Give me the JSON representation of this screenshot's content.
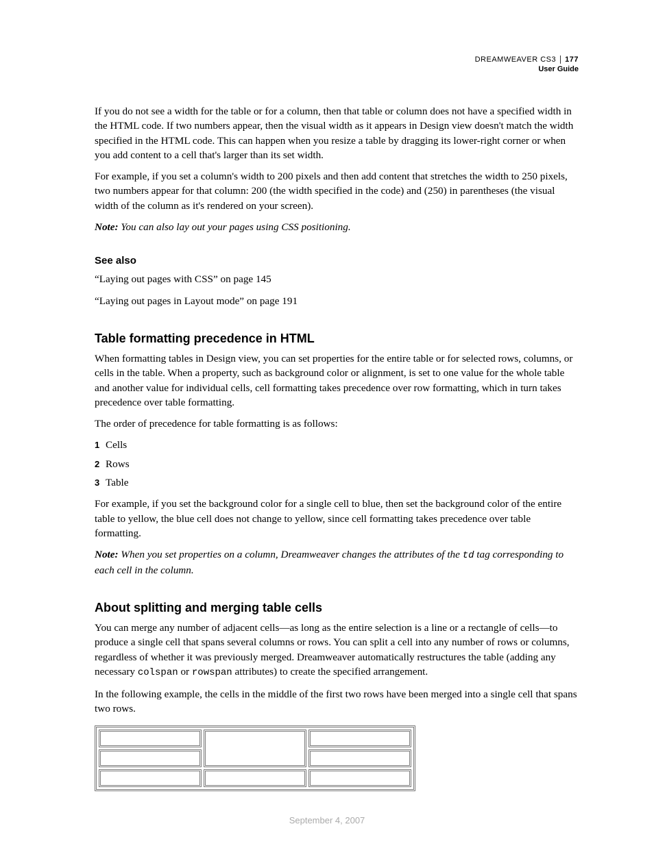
{
  "header": {
    "product": "DREAMWEAVER CS3",
    "subtitle": "User Guide",
    "page_number": "177"
  },
  "paragraphs": {
    "intro1": "If you do not see a width for the table or for a column, then that table or column does not have a specified width in the HTML code. If two numbers appear, then the visual width as it appears in Design view doesn't match the width specified in the HTML code. This can happen when you resize a table by dragging its lower-right corner or when you add content to a cell that's larger than its set width.",
    "intro2": "For example, if you set a column's width to 200 pixels and then add content that stretches the width to 250 pixels, two numbers appear for that column: 200 (the width specified in the code) and (250) in parentheses (the visual width of the column as it's rendered on your screen).",
    "note1_label": "Note:",
    "note1_text": " You can also lay out your pages using CSS positioning.",
    "see_also_heading": "See also",
    "see_also_1": "“Laying out pages with CSS” on page 145",
    "see_also_2": "“Laying out pages in Layout mode” on page 191",
    "sec1_heading": "Table formatting precedence in HTML",
    "sec1_p1": "When formatting tables in Design view, you can set properties for the entire table or for selected rows, columns, or cells in the table. When a property, such as background color or alignment, is set to one value for the whole table and another value for individual cells, cell formatting takes precedence over row formatting, which in turn takes precedence over table formatting.",
    "sec1_p2": "The order of precedence for table formatting is as follows:",
    "list": [
      {
        "n": "1",
        "t": "Cells"
      },
      {
        "n": "2",
        "t": "Rows"
      },
      {
        "n": "3",
        "t": "Table"
      }
    ],
    "sec1_p3": "For example, if you set the background color for a single cell to blue, then set the background color of the entire table to yellow, the blue cell does not change to yellow, since cell formatting takes precedence over table formatting.",
    "note2_label": "Note:",
    "note2_text_a": " When you set properties on a column, Dreamweaver changes the attributes of the ",
    "note2_code": "td",
    "note2_text_b": " tag corresponding to each cell in the column.",
    "sec2_heading": "About splitting and merging table cells",
    "sec2_p1_a": "You can merge any number of adjacent cells—as long as the entire selection is a line or a rectangle of cells—to produce a single cell that spans several columns or rows. You can split a cell into any number of rows or columns, regardless of whether it was previously merged. Dreamweaver automatically restructures the table (adding any necessary ",
    "sec2_code1": "colspan",
    "sec2_p1_b": " or ",
    "sec2_code2": "rowspan",
    "sec2_p1_c": " attributes) to create the specified arrangement.",
    "sec2_p2": "In the following example, the cells in the middle of the first two rows have been merged into a single cell that spans two rows."
  },
  "footer": {
    "date": "September 4, 2007"
  }
}
